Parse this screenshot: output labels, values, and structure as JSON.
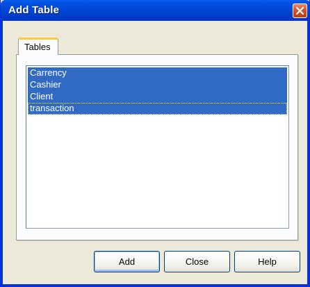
{
  "window": {
    "title": "Add Table",
    "close_symbol": "×"
  },
  "tabs": [
    {
      "label": "Tables",
      "active": true
    }
  ],
  "tables_list": {
    "items": [
      {
        "label": "Carrency",
        "selected": true,
        "focused": false
      },
      {
        "label": "Cashier",
        "selected": true,
        "focused": false
      },
      {
        "label": "Client",
        "selected": true,
        "focused": false
      },
      {
        "label": "transaction",
        "selected": true,
        "focused": true
      }
    ],
    "selection_color": "#316ac5"
  },
  "buttons": {
    "add_label": "Add",
    "close_label": "Close",
    "help_label": "Help"
  },
  "colors": {
    "titlebar_blue": "#0047d6",
    "close_red": "#d9502a",
    "dialog_background": "#ece9d8",
    "tab_highlight": "#ffc83c"
  }
}
